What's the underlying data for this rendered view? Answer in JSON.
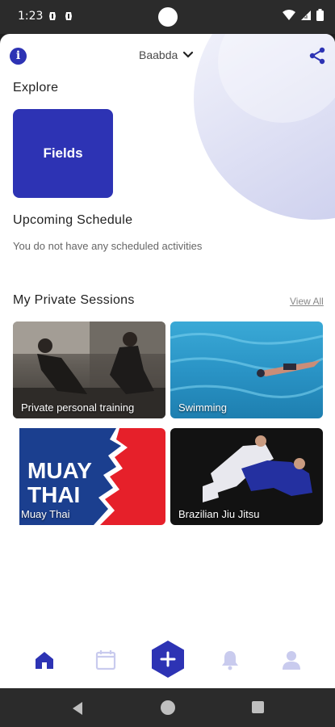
{
  "status_bar": {
    "time": "1:23",
    "icons": [
      "notification-icon",
      "notification-icon",
      "wifi-icon",
      "signal-icon",
      "battery-icon"
    ]
  },
  "header": {
    "location": "Baabda",
    "info_icon": "info-icon",
    "share_icon": "share-icon"
  },
  "explore": {
    "title": "Explore",
    "tiles": [
      {
        "label": "Fields",
        "color": "#2d33b4"
      }
    ]
  },
  "upcoming": {
    "title": "Upcoming Schedule",
    "empty_text": "You do not have any scheduled activities"
  },
  "private_sessions": {
    "title": "My Private Sessions",
    "view_all": "View All",
    "cards": [
      {
        "label": "Private personal training"
      },
      {
        "label": "Swimming"
      },
      {
        "label": "Muay Thai",
        "logo_text_1": "MUAY",
        "logo_text_2": "THAI"
      },
      {
        "label": "Brazilian Jiu Jitsu"
      }
    ]
  },
  "bottom_nav": {
    "items": [
      "home-icon",
      "calendar-icon",
      "add-icon",
      "bell-icon",
      "profile-icon"
    ],
    "active": "home-icon",
    "accent_color": "#2d33b4",
    "inactive_color": "#c9cbee"
  }
}
